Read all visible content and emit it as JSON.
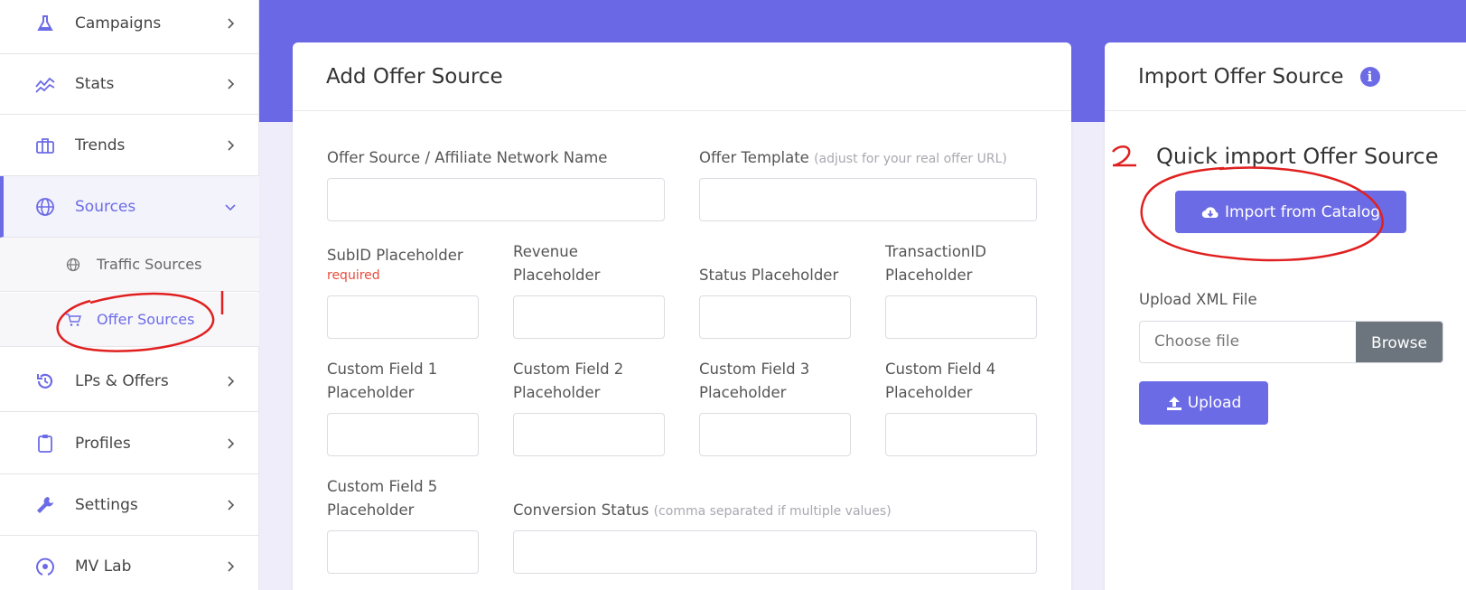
{
  "sidebar": {
    "items": [
      {
        "label": "Campaigns",
        "icon": "flask-icon"
      },
      {
        "label": "Stats",
        "icon": "chart-line-icon"
      },
      {
        "label": "Trends",
        "icon": "briefcase-icon"
      },
      {
        "label": "Sources",
        "icon": "globe-icon"
      },
      {
        "label": "LPs & Offers",
        "icon": "history-icon"
      },
      {
        "label": "Profiles",
        "icon": "clipboard-icon"
      },
      {
        "label": "Settings",
        "icon": "wrench-icon"
      },
      {
        "label": "MV Lab",
        "icon": "atom-icon"
      }
    ],
    "sub_items": [
      {
        "label": "Traffic Sources",
        "icon": "globe-icon"
      },
      {
        "label": "Offer Sources",
        "icon": "cart-icon"
      }
    ]
  },
  "add_form": {
    "title": "Add Offer Source",
    "network_name_label": "Offer Source / Affiliate Network Name",
    "offer_template_label": "Offer Template",
    "offer_template_hint": "(adjust for your real offer URL)",
    "subid_label": "SubID Placeholder",
    "subid_required": "required",
    "revenue_label": "Revenue Placeholder",
    "status_label": "Status Placeholder",
    "transaction_label": "TransactionID Placeholder",
    "custom1_label": "Custom Field 1 Placeholder",
    "custom2_label": "Custom Field 2 Placeholder",
    "custom3_label": "Custom Field 3 Placeholder",
    "custom4_label": "Custom Field 4 Placeholder",
    "custom5_label": "Custom Field 5 Placeholder",
    "conversion_label": "Conversion Status",
    "conversion_hint": "(comma separated if multiple values)"
  },
  "import_panel": {
    "title": "Import Offer Source",
    "quick_import_title": "Quick import Offer Source",
    "catalog_button": "Import from Catalog",
    "upload_label": "Upload XML File",
    "file_placeholder": "Choose file",
    "browse_button": "Browse",
    "upload_button": "Upload"
  },
  "annotations": {
    "mark_1": "1",
    "mark_2": "2"
  },
  "colors": {
    "accent": "#6c6be6",
    "banner": "#6b68e6",
    "annotation": "#e02020",
    "required": "#e74c3c"
  }
}
